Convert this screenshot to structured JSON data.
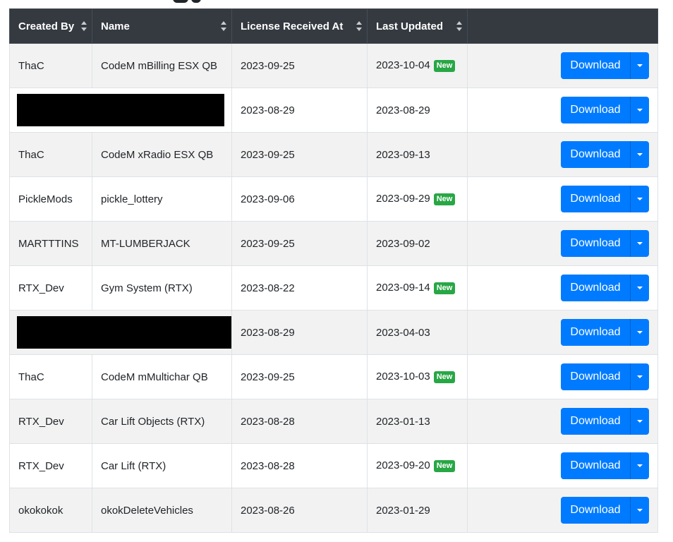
{
  "columns": [
    {
      "label": "Created By"
    },
    {
      "label": "Name"
    },
    {
      "label": "License Received At"
    },
    {
      "label": "Last Updated"
    },
    {
      "label": ""
    }
  ],
  "download_label": "Download",
  "new_badge_label": "New",
  "rows": [
    {
      "created_by": "ThaC",
      "name": "CodeM mBilling ESX QB",
      "license_received": "2023-09-25",
      "last_updated": "2023-10-04",
      "is_new": true
    },
    {
      "created_by": "",
      "name": "",
      "license_received": "2023-08-29",
      "last_updated": "2023-08-29",
      "is_new": false,
      "redacted": true
    },
    {
      "created_by": "ThaC",
      "name": "CodeM xRadio ESX QB",
      "license_received": "2023-09-25",
      "last_updated": "2023-09-13",
      "is_new": false
    },
    {
      "created_by": "PickleMods",
      "name": "pickle_lottery",
      "license_received": "2023-09-06",
      "last_updated": "2023-09-29",
      "is_new": true
    },
    {
      "created_by": "MARTTTINS",
      "name": "MT-LUMBERJACK",
      "license_received": "2023-09-25",
      "last_updated": "2023-09-02",
      "is_new": false
    },
    {
      "created_by": "RTX_Dev",
      "name": "Gym System (RTX)",
      "license_received": "2023-08-22",
      "last_updated": "2023-09-14",
      "is_new": true
    },
    {
      "created_by": "",
      "name": "",
      "license_received": "2023-08-29",
      "last_updated": "2023-04-03",
      "is_new": false,
      "redacted": true
    },
    {
      "created_by": "ThaC",
      "name": "CodeM mMultichar QB",
      "license_received": "2023-09-25",
      "last_updated": "2023-10-03",
      "is_new": true
    },
    {
      "created_by": "RTX_Dev",
      "name": "Car Lift Objects (RTX)",
      "license_received": "2023-08-28",
      "last_updated": "2023-01-13",
      "is_new": false
    },
    {
      "created_by": "RTX_Dev",
      "name": "Car Lift (RTX)",
      "license_received": "2023-08-28",
      "last_updated": "2023-09-20",
      "is_new": true
    },
    {
      "created_by": "okokokok",
      "name": "okokDeleteVehicles",
      "license_received": "2023-08-26",
      "last_updated": "2023-01-29",
      "is_new": false
    }
  ],
  "colors": {
    "header_bg": "#343a40",
    "button": "#007bff",
    "badge": "#28a745",
    "stripe": "#f2f2f2"
  }
}
